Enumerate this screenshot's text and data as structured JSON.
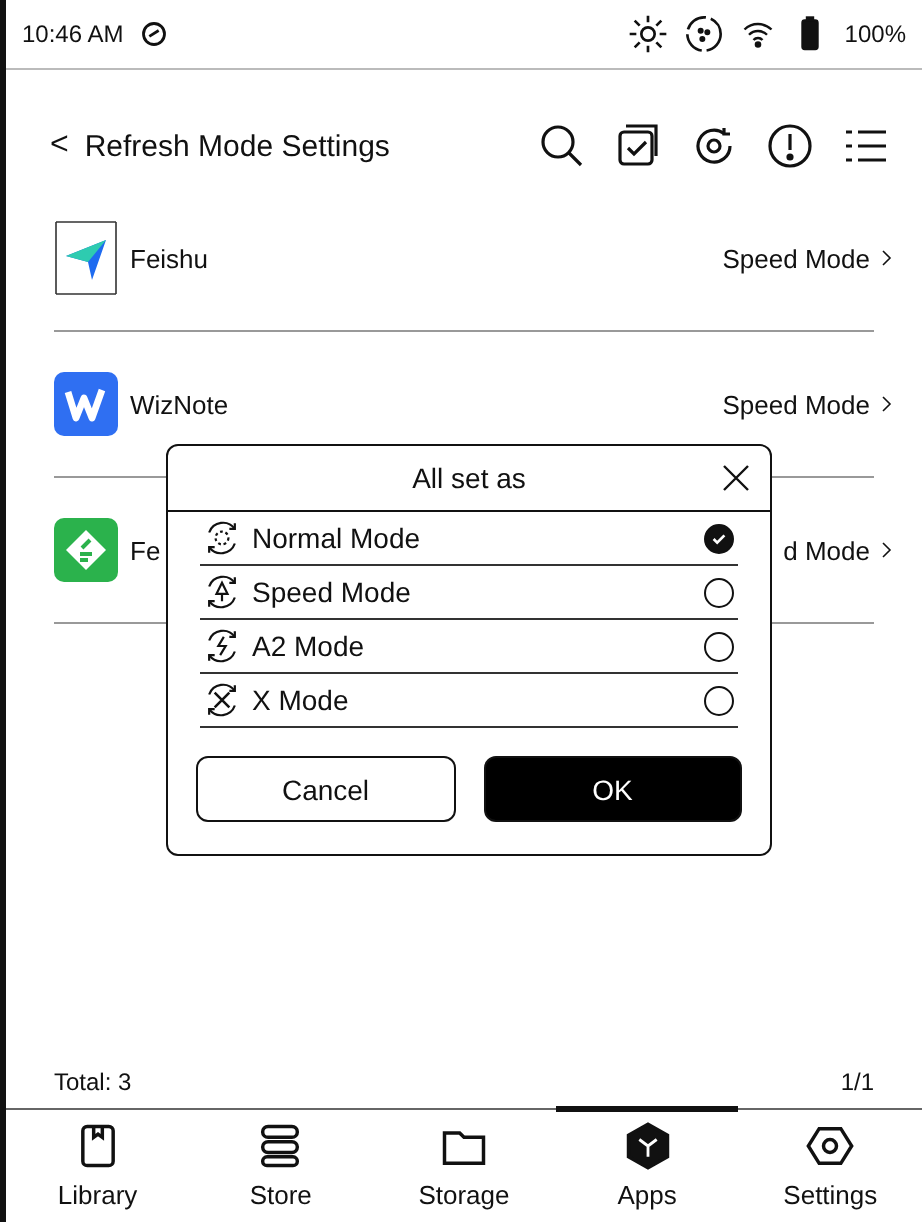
{
  "status_bar": {
    "time": "10:46 AM",
    "battery": "100%"
  },
  "header": {
    "back": "<",
    "title": "Refresh Mode Settings"
  },
  "apps": [
    {
      "name": "Feishu",
      "mode": "Speed Mode"
    },
    {
      "name": "WizNote",
      "mode": "Speed Mode"
    },
    {
      "name": "Fe",
      "mode": "d Mode"
    }
  ],
  "dialog": {
    "title": "All set as",
    "options": [
      {
        "label": "Normal Mode",
        "selected": true
      },
      {
        "label": "Speed Mode",
        "selected": false
      },
      {
        "label": "A2 Mode",
        "selected": false
      },
      {
        "label": "X Mode",
        "selected": false
      }
    ],
    "buttons": [
      {
        "label": "Cancel",
        "kind": "secondary"
      },
      {
        "label": "OK",
        "kind": "primary"
      }
    ]
  },
  "footer": {
    "total": "Total: 3",
    "page": "1/1"
  },
  "nav": [
    {
      "label": "Library",
      "selected": false
    },
    {
      "label": "Store",
      "selected": false
    },
    {
      "label": "Storage",
      "selected": false
    },
    {
      "label": "Apps",
      "selected": true
    },
    {
      "label": "Settings",
      "selected": false
    }
  ]
}
